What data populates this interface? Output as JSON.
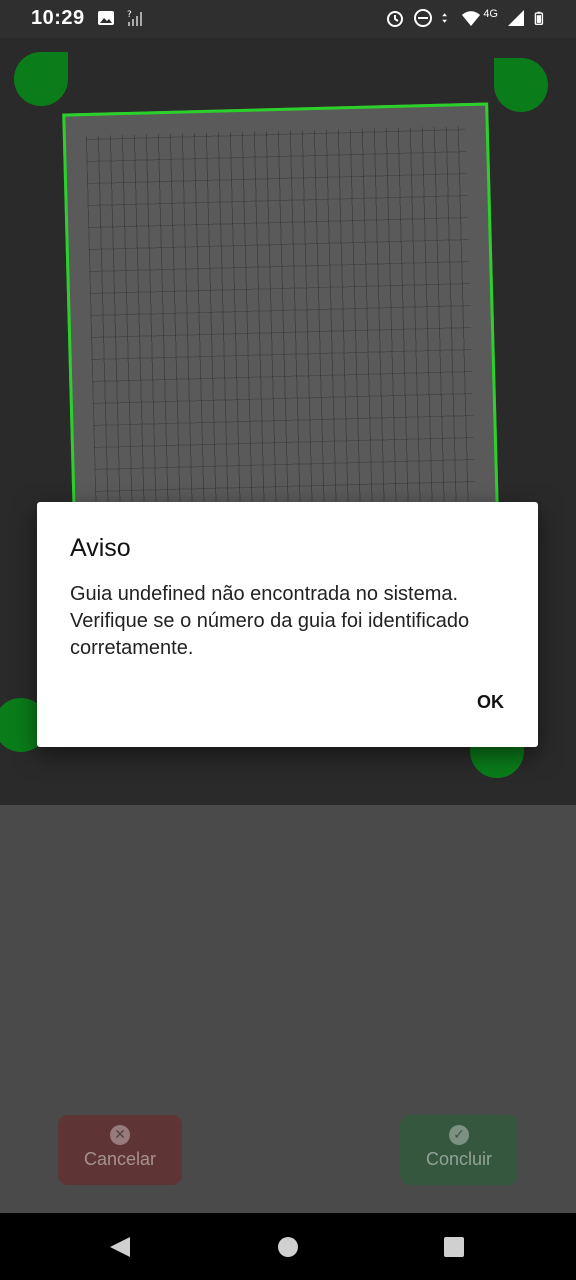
{
  "status_bar": {
    "time": "10:29",
    "network_label": "4G",
    "icons_left": [
      "image-icon",
      "no-signal-icon"
    ],
    "icons_right": [
      "alarm-icon",
      "do-not-disturb-icon",
      "data-arrows-icon",
      "wifi-icon",
      "signal-icon",
      "battery-icon"
    ]
  },
  "camera_view": {
    "border_color": "#2ad12a",
    "corner_color": "#0a7d1a"
  },
  "buttons": {
    "cancel_label": "Cancelar",
    "confirm_label": "Concluir",
    "cancel_icon": "close-circle-icon",
    "confirm_icon": "check-circle-icon"
  },
  "dialog": {
    "title": "Aviso",
    "message": "Guia undefined não encontrada no sistema. Verifique se o número da guia foi identificado corretamente.",
    "ok_label": "OK"
  },
  "nav_bar": {
    "icons": [
      "back-icon",
      "home-icon",
      "recents-icon"
    ]
  }
}
